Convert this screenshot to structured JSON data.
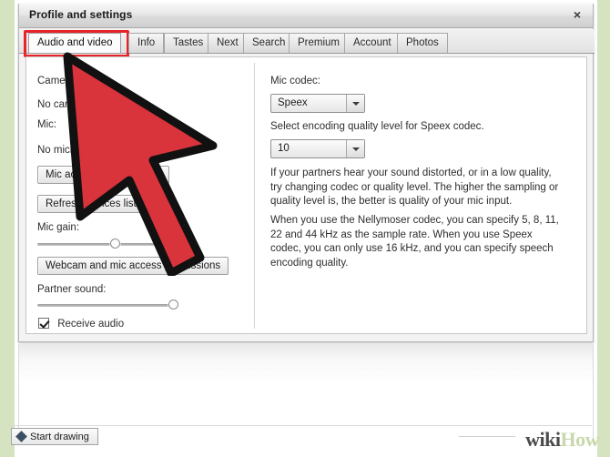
{
  "window": {
    "title": "Profile and settings",
    "close_label": "×"
  },
  "tabs": [
    {
      "label": "Audio and video",
      "active": true
    },
    {
      "label": "Info",
      "active": false
    },
    {
      "label": "Tastes",
      "active": false
    },
    {
      "label": "Next",
      "active": false
    },
    {
      "label": "Search",
      "active": false
    },
    {
      "label": "Premium",
      "active": false
    },
    {
      "label": "Account",
      "active": false
    },
    {
      "label": "Photos",
      "active": false
    }
  ],
  "left_column": {
    "camera_label": "Camera:",
    "camera_status": "No camera found",
    "mic_label": "Mic:",
    "mic_status": "No microphone found",
    "mic_activity_button": "Mic activity level and test",
    "refresh_button": "Refresh devices list",
    "mic_gain_label": "Mic gain:",
    "mic_gain_value": 55,
    "permissions_button": "Webcam and mic access permissions",
    "partner_sound_label": "Partner sound:",
    "partner_sound_value": 96,
    "receive_audio_label": "Receive audio",
    "receive_audio_checked": true
  },
  "right_column": {
    "mic_codec_label": "Mic codec:",
    "codec_value": "Speex",
    "quality_hint": "Select encoding quality level for Speex codec.",
    "quality_value": "10",
    "paragraph_1": "If your partners hear your sound distorted, or in a low quality, try changing codec or quality level. The higher the sampling or quality level is, the better is quality of your mic input.",
    "paragraph_2": "When you use the Nellymoser codec, you can specify 5, 8, 11, 22 and 44 kHz as the sample rate. When you use Speex codec, you can only use 16 kHz, and you can specify speech encoding quality."
  },
  "footer": {
    "start_drawing_label": "Start drawing"
  },
  "watermark": {
    "part_a": "wiki",
    "part_b": "How"
  },
  "annotation": {
    "highlight_color": "#e8232a",
    "cursor_color": "#d9333c"
  }
}
